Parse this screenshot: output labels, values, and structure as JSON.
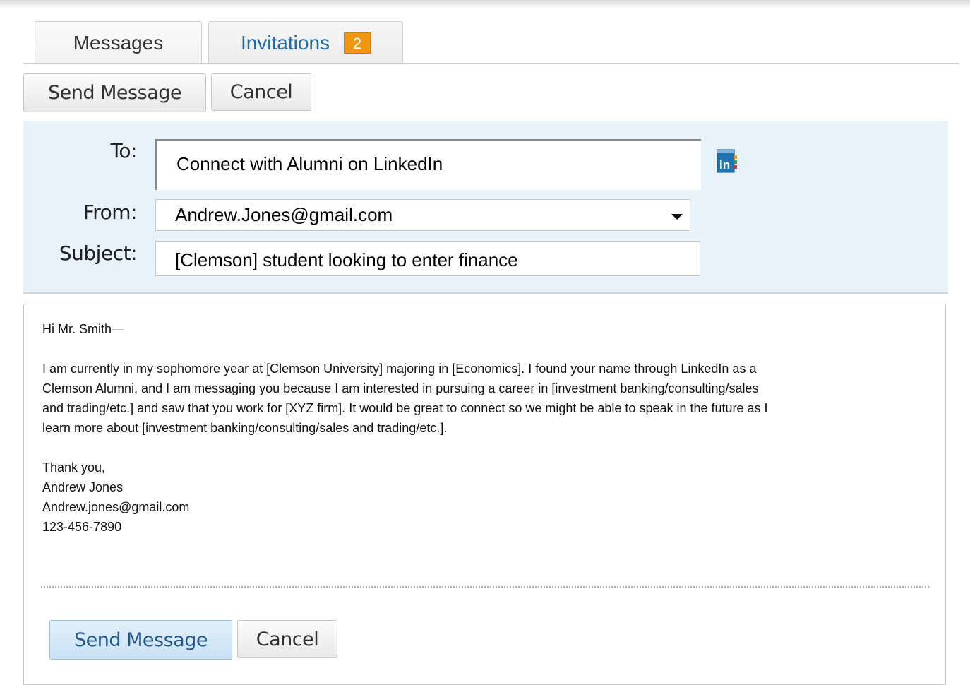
{
  "tabs": [
    {
      "label": "Messages"
    },
    {
      "label": "Invitations",
      "badge": "2"
    }
  ],
  "toolbar": {
    "send_label": "Send Message",
    "cancel_label": "Cancel"
  },
  "form": {
    "to_label": "To:",
    "to_value": "Connect with Alumni on LinkedIn",
    "from_label": "From:",
    "from_value": "Andrew.Jones@gmail.com",
    "subject_label": "Subject:",
    "subject_value": "[Clemson] student looking to enter finance",
    "address_book_icon": "linkedin-address-book-icon"
  },
  "message": {
    "greeting": "Hi Mr. Smith—",
    "line1": "I am currently in my sophomore year at [Clemson University] majoring in [Economics]. I found your name through LinkedIn as a",
    "line2": "Clemson Alumni, and I am messaging you because I am interested in pursuing a career in [investment banking/consulting/sales",
    "line3": "and trading/etc.] and saw that you work for [XYZ firm]. It would be great to connect so we might be able to speak in the future as I",
    "line4": "learn more about [investment banking/consulting/sales and trading/etc.].",
    "closing": "Thank you,",
    "name": "Andrew Jones",
    "email": "Andrew.jones@gmail.com",
    "phone": "123-456-7890"
  },
  "footer": {
    "send_label": "Send Message",
    "cancel_label": "Cancel"
  },
  "colors": {
    "link_blue": "#1f6aa8",
    "badge_orange": "#f09613",
    "panel_blue": "#e8f2fb",
    "linkedin_blue": "#1f74b1"
  }
}
